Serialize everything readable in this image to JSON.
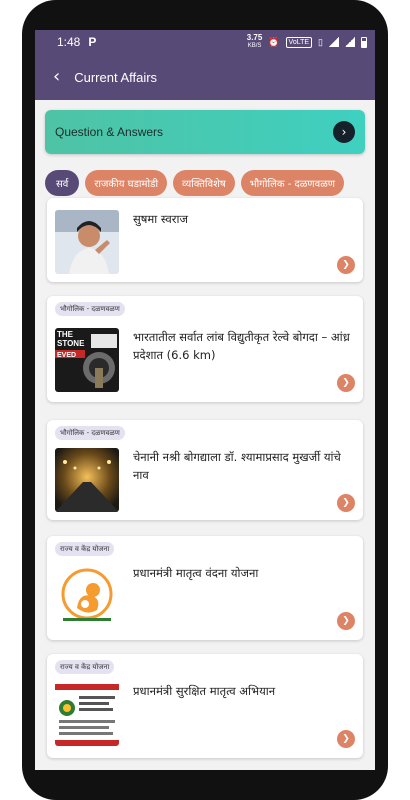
{
  "status_bar": {
    "time": "1:48",
    "app_icon": "P",
    "net_speed_value": "3.75",
    "net_speed_unit": "KB/S",
    "volte": "VoLTE"
  },
  "app_bar": {
    "back_icon": "chevron-left-icon",
    "title": "Current Affairs"
  },
  "banner": {
    "label": "Question & Answers",
    "icon": "chevron-right-icon"
  },
  "chips": [
    {
      "label": "सर्व",
      "active": true
    },
    {
      "label": "राजकीय घडामोडी",
      "active": false
    },
    {
      "label": "व्यक्तिविशेष",
      "active": false
    },
    {
      "label": "भौगोलिक - दळणवळण",
      "active": false
    }
  ],
  "cards": [
    {
      "tag": "",
      "title": "सुषमा स्वराज",
      "thumb": "portrait"
    },
    {
      "tag": "भौगोलिक - दळणवळण",
      "title": "भारतातील सर्वात लांब विद्युतीकृत रेल्वे बोगदा – आंध्र प्रदेशात  (6.6 km)",
      "thumb": "tunnel-poster",
      "thumb_texts": [
        "THE",
        "STONE",
        "EVED"
      ]
    },
    {
      "tag": "भौगोलिक - दळणवळण",
      "title": "चेनानी  नश्री बोगद्याला डॉ. श्यामाप्रसाद मुखर्जी यांचे नाव",
      "thumb": "tunnel-lights"
    },
    {
      "tag": "राज्य व केंद्र योजना",
      "title": "प्रधानमंत्री मातृत्व वंदना योजना",
      "thumb": "scheme-logo"
    },
    {
      "tag": "राज्य व केंद्र योजना",
      "title": "प्रधानमंत्री सुरक्षित मातृत्व अभियान",
      "thumb": "scheme-poster"
    }
  ],
  "colors": {
    "primary": "#574a77",
    "accent": "#dd8466",
    "banner_start": "#4ec3a5",
    "banner_end": "#3fd0c0",
    "tag_bg": "#e4e2f0"
  }
}
